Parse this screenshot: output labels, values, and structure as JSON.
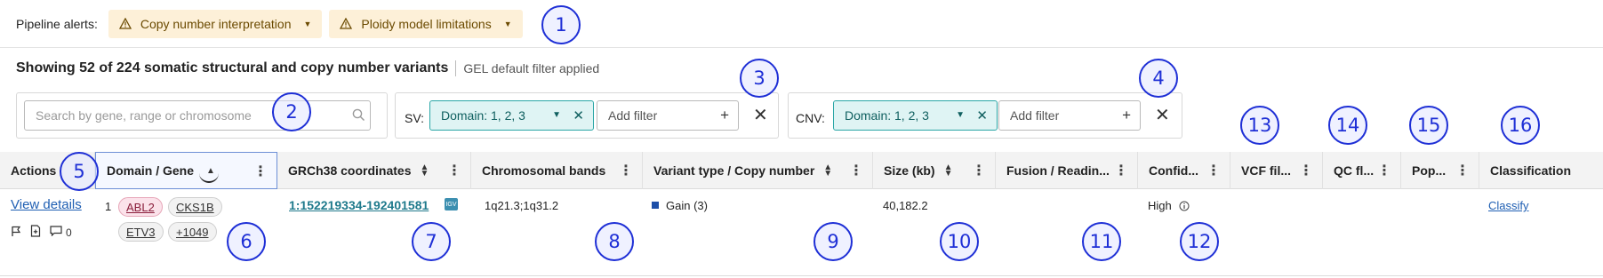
{
  "alerts": {
    "label": "Pipeline alerts:",
    "chips": [
      "Copy number interpretation",
      "Ploidy model limitations"
    ]
  },
  "summary": {
    "title": "Showing 52 of 224 somatic structural and copy number variants",
    "filter_note": "GEL default filter applied"
  },
  "search": {
    "placeholder": "Search by gene, range or chromosome"
  },
  "sv_filter": {
    "label": "SV:",
    "domain_chip": "Domain: 1, 2, 3",
    "add_filter": "Add filter"
  },
  "cnv_filter": {
    "label": "CNV:",
    "domain_chip": "Domain: 1, 2, 3",
    "add_filter": "Add filter"
  },
  "table": {
    "columns": [
      "Actions",
      "Domain / Gene",
      "GRCh38 coordinates",
      "Chromosomal bands",
      "Variant type / Copy number",
      "Size (kb)",
      "Fusion / Readin...",
      "Confid...",
      "VCF fil...",
      "QC fl...",
      "Pop...",
      "Classification"
    ],
    "rows": [
      {
        "view_details": "View details",
        "comment_count": "0",
        "domain": "1",
        "genes": [
          "ABL2",
          "CKS1B",
          "ETV3",
          "+1049"
        ],
        "coordinates": "1:152219334-192401581",
        "igv_label": "IGV",
        "bands": "1q21.3;1q31.2",
        "variant_type": "Gain (3)",
        "size_kb": "40,182.2",
        "confidence": "High",
        "classification": "Classify"
      }
    ]
  },
  "markers": [
    "1",
    "2",
    "3",
    "4",
    "5",
    "6",
    "7",
    "8",
    "9",
    "10",
    "11",
    "12",
    "13",
    "14",
    "15",
    "16"
  ],
  "colors": {
    "alert_bg": "#fdf0d8",
    "domain_chip_bg": "#dff4f4",
    "domain_chip_border": "#2aa6a6",
    "link": "#1f5fb3",
    "marker": "#1e2fd6",
    "gene_highlight": "#fbe2ea"
  }
}
